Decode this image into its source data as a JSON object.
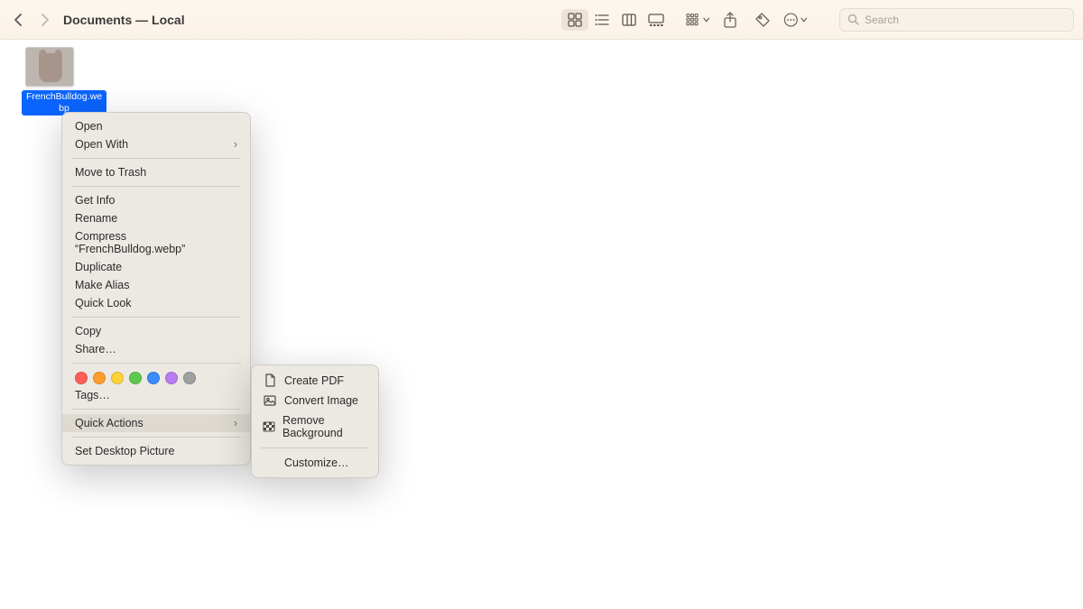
{
  "toolbar": {
    "title": "Documents — Local",
    "search_placeholder": "Search"
  },
  "file": {
    "name": "FrenchBulldog.we\nbp"
  },
  "context_menu": {
    "open": "Open",
    "open_with": "Open With",
    "move_to_trash": "Move to Trash",
    "get_info": "Get Info",
    "rename": "Rename",
    "compress": "Compress “FrenchBulldog.webp”",
    "duplicate": "Duplicate",
    "make_alias": "Make Alias",
    "quick_look": "Quick Look",
    "copy": "Copy",
    "share": "Share…",
    "tags": "Tags…",
    "quick_actions": "Quick Actions",
    "set_desktop": "Set Desktop Picture",
    "tag_colors": [
      "#ff5f57",
      "#ff9e2c",
      "#ffd23a",
      "#5ec94f",
      "#3a8cff",
      "#b77cf0",
      "#a0a0a0"
    ]
  },
  "quick_actions_submenu": {
    "create_pdf": "Create PDF",
    "convert_image": "Convert Image",
    "remove_background": "Remove Background",
    "customize": "Customize…"
  }
}
